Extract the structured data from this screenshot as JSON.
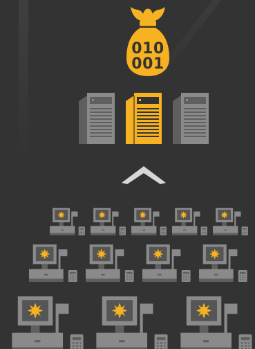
{
  "colors": {
    "background": "#333333",
    "accent": "#f6b221",
    "device_gray": "#8a8a8a",
    "device_dark": "#5f5f5f",
    "highlight_white": "#d7d7d7"
  },
  "bag": {
    "icon": "money-bag-icon",
    "binary_lines": [
      "010",
      "001"
    ]
  },
  "servers": [
    {
      "icon": "server-tower-icon",
      "state": "idle"
    },
    {
      "icon": "server-tower-icon",
      "state": "highlighted"
    },
    {
      "icon": "server-tower-icon",
      "state": "idle"
    }
  ],
  "caret": {
    "icon": "chevron-up-icon"
  },
  "terminal_rows": [
    {
      "count": 5,
      "icon": "pos-terminal-icon"
    },
    {
      "count": 4,
      "icon": "pos-terminal-icon"
    },
    {
      "count": 3,
      "icon": "pos-terminal-icon"
    }
  ]
}
